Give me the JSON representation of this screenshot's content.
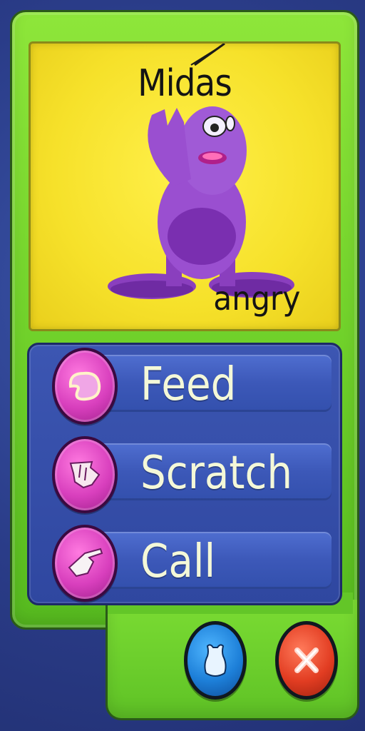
{
  "pet": {
    "name": "Midas",
    "mood": "angry"
  },
  "menu": {
    "items": [
      {
        "label": "Feed",
        "icon": "jellybean-icon"
      },
      {
        "label": "Scratch",
        "icon": "scratch-hand-icon"
      },
      {
        "label": "Call",
        "icon": "pointing-hand-icon"
      }
    ]
  },
  "buttons": {
    "teleport_icon": "pet-silhouette-icon",
    "close_icon": "close-x-icon"
  },
  "colors": {
    "panel_green": "#6fd02a",
    "portrait_yellow": "#f6e12a",
    "menu_blue": "#3350ad",
    "icon_magenta": "#d83fbd",
    "teleport_blue": "#1d7fd8",
    "close_red": "#e23d22"
  }
}
